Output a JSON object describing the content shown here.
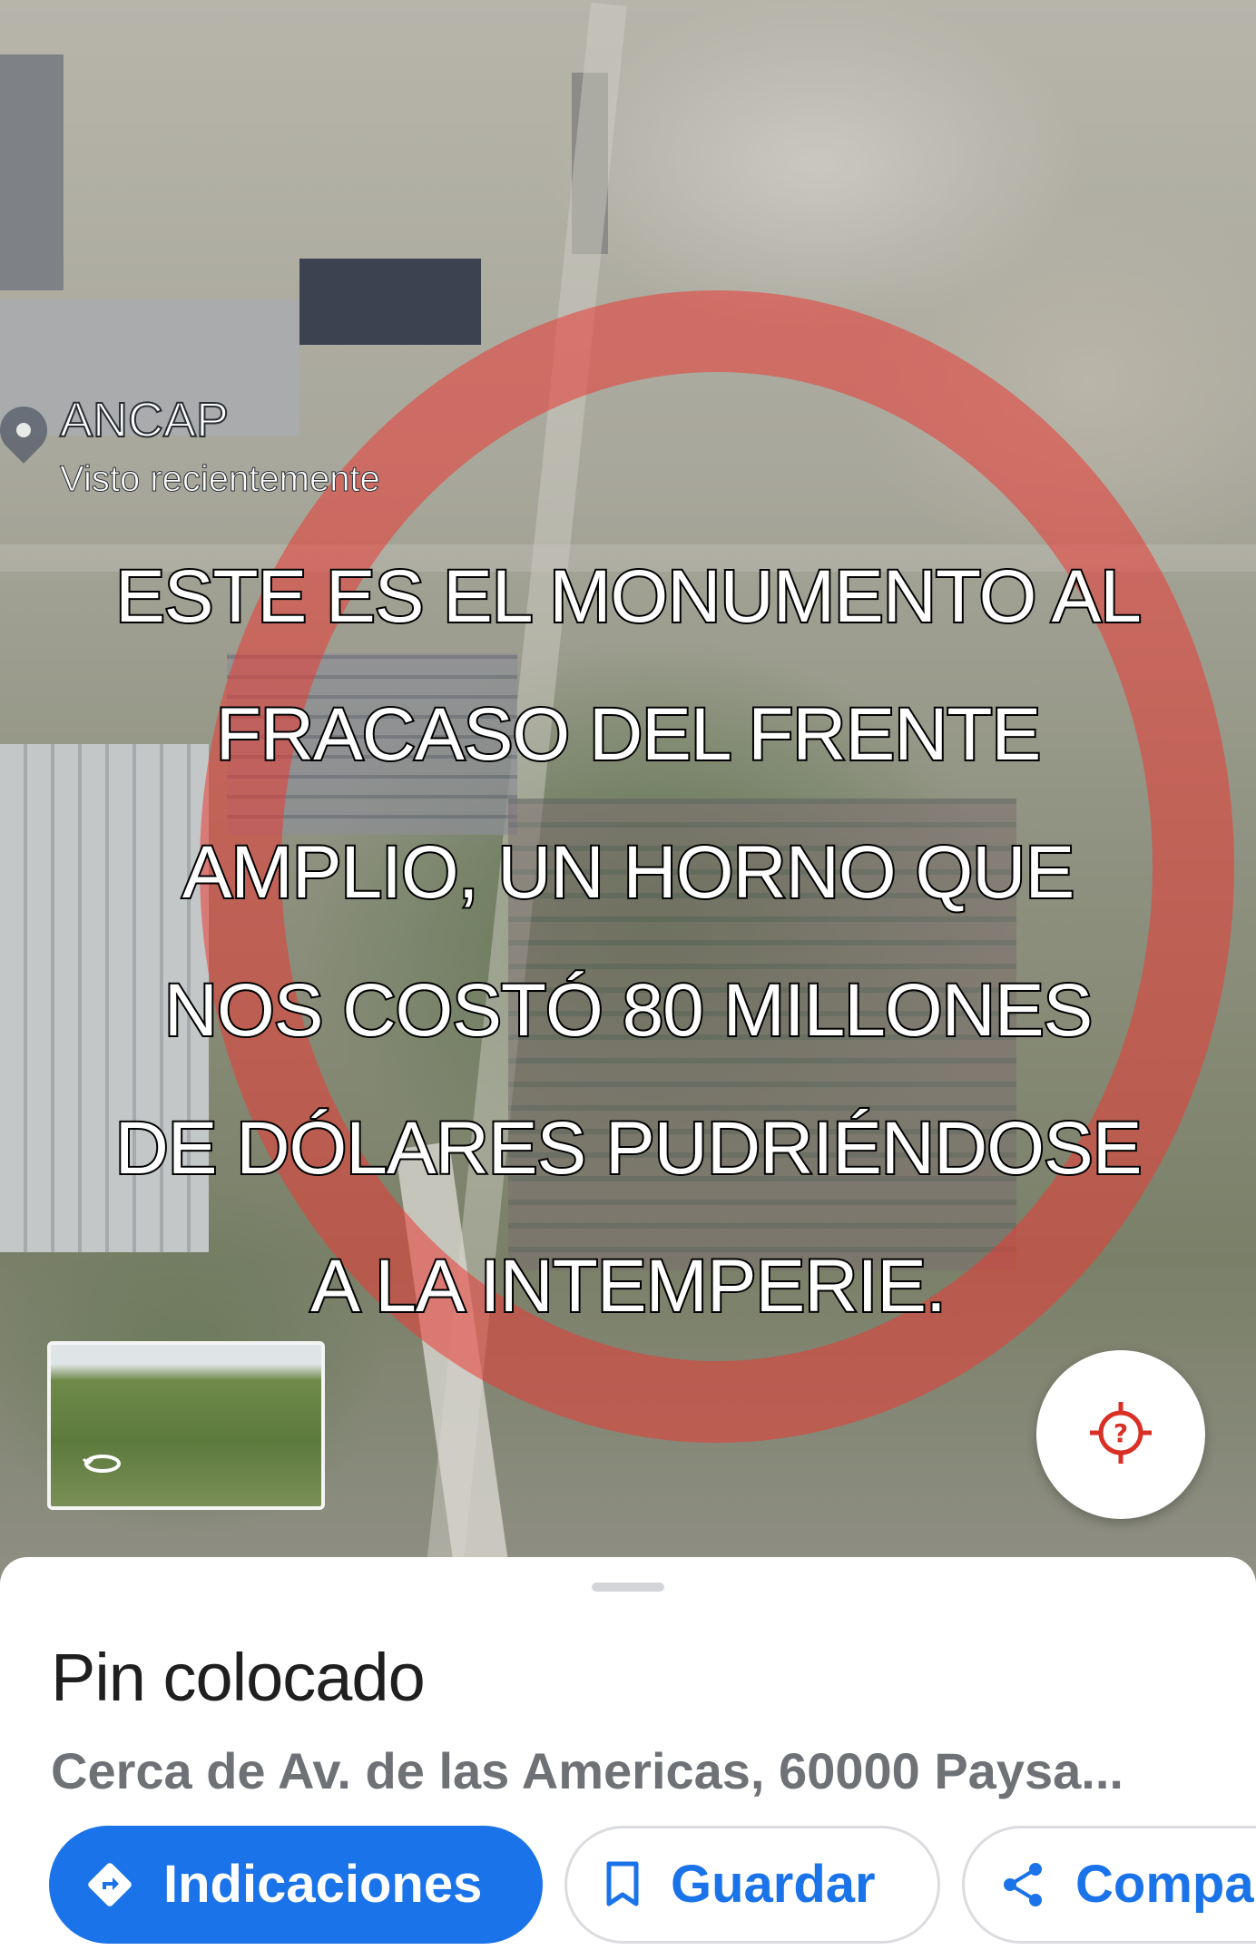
{
  "map": {
    "place_label": "ANCAP",
    "place_sublabel": "Visto recientemente"
  },
  "overlay_caption": "ESTE ES EL MONUMENTO AL\nFRACASO DEL FRENTE\nAMPLIO, UN HORNO QUE\nNOS COSTÓ 80 MILLONES\nDE DÓLARES PUDRIÉNDOSE\nA LA INTEMPERIE.",
  "sheet": {
    "title": "Pin colocado",
    "address": "Cerca de Av. de las Americas, 60000 Paysa...",
    "actions": [
      {
        "label": "Indicaciones",
        "icon": "directions-icon"
      },
      {
        "label": "Guardar",
        "icon": "bookmark-icon"
      },
      {
        "label": "Compa",
        "icon": "share-icon"
      }
    ]
  },
  "colors": {
    "accent": "#1a73e8",
    "highlight_ring": "#ea3a34",
    "fab_icon": "#d93025"
  },
  "icons": {
    "fab": "location-help-icon",
    "thumbnail": "street-view-360-icon",
    "place": "map-pin-icon"
  }
}
